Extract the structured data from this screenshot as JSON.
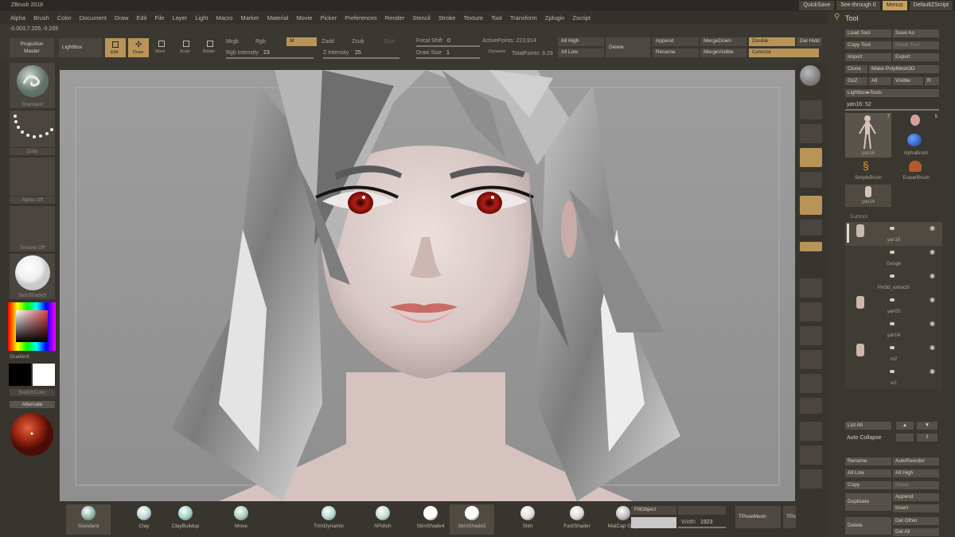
{
  "app": {
    "title": "ZBrush 2018"
  },
  "topbar": [
    "QuickSave",
    "See-through  0",
    "Menus",
    "DefaultZScript"
  ],
  "menus": [
    "Alpha",
    "Brush",
    "Color",
    "Document",
    "Draw",
    "Edit",
    "File",
    "Layer",
    "Light",
    "Macro",
    "Marker",
    "Material",
    "Movie",
    "Picker",
    "Preferences",
    "Render",
    "Stencil",
    "Stroke",
    "Texture",
    "Tool",
    "Transform",
    "Zplugin",
    "Zscript"
  ],
  "coords": "-0.003,7.205,-0.205",
  "shelf": {
    "projection_master": "Projection\nMaster",
    "lightbox": "LightBox",
    "edit": "Edit",
    "draw": "Draw",
    "move": "Move",
    "scale": "Scale",
    "rotate": "Rotate",
    "mrgb": "Mrgb",
    "rgb": "Rgb",
    "m": "M",
    "zadd": "Zadd",
    "zsub": "Zsub",
    "zcut": "Zcut",
    "rgb_intensity_label": "Rgb Intensity",
    "rgb_intensity_value": "23",
    "z_intensity_label": "Z Intensity",
    "z_intensity_value": "25",
    "focal_shift_label": "Focal Shift",
    "focal_shift_value": "0",
    "draw_size_label": "Draw Size",
    "draw_size_value": "1",
    "dynamic": "Dynamic",
    "active_points": "ActivePoints: 223,914",
    "total_points": "TotalPoints: 9.29",
    "all_high": "All High",
    "all_low": "All Low",
    "delete": "Delete",
    "append": "Append",
    "rename": "Rename",
    "merge_down": "MergeDown",
    "merge_visible": "MergeVisible",
    "double": "Double",
    "colorize": "Colorize",
    "del_hidden": "Del Hidd",
    "zero": "0"
  },
  "left": {
    "brush": "Standard",
    "stroke": "Dots",
    "alpha": "Alpha Off",
    "texture": "Texture Off",
    "material": "SkinShade5",
    "gradient": "Gradient",
    "switch_color": "SwitchColor",
    "alternate": "Alternate"
  },
  "right_shelf": [
    "",
    "",
    "Actual",
    "AAHalf",
    "Persp",
    "Floor",
    "Local",
    "L.Sym",
    "Gxyz",
    "",
    "",
    "Frame",
    "Move",
    "Scale",
    "Rotate",
    "Line Fill PolyF",
    "Transp",
    "Ghost",
    "Solo",
    "Xpose"
  ],
  "tool": {
    "title": "Tool",
    "load": "Load Tool",
    "save_as": "Save As",
    "copy": "Copy Tool",
    "paste": "Paste Tool",
    "import": "Import",
    "export": "Export",
    "clone": "Clone",
    "make_polymesh": "Make PolyMesh3D",
    "goz": "GoZ",
    "all": "All",
    "visible": "Visible",
    "r": "R",
    "lightbox_tools": "Lightbox▸Tools",
    "current": "yan16: 52",
    "thumbs": [
      {
        "label": "yan16",
        "count": "7"
      },
      {
        "label": "AlphaBrush",
        "count": "5"
      },
      {
        "label": "SimpleBrush",
        "count": ""
      },
      {
        "label": "EraserBrush",
        "count": ""
      },
      {
        "label": "yan16",
        "count": ""
      }
    ],
    "subtool_title": "Subtool",
    "subtools": [
      "yan16",
      "Geoge",
      "Pm3d_extract0",
      "yan03",
      "yan04",
      "m2",
      "w1"
    ],
    "list_all": "List All",
    "auto_collapse": "Auto Collapse",
    "rename": "Rename",
    "auto_reorder": "AutoReorder",
    "all_low": "All Low",
    "all_high": "All High",
    "copy2": "Copy",
    "paste2": "Paste",
    "duplicate": "Duplicate",
    "append": "Append",
    "insert": "Insert",
    "delete": "Delete",
    "del_other": "Del Other",
    "del_all": "Del All"
  },
  "bottom": {
    "materials": [
      "Standard",
      "Clay",
      "ClayBuildup",
      "Move",
      "TrimDynamic",
      "hPolish",
      "SkinShade4",
      "SkinShade5",
      "Slim",
      "FastShader",
      "MatCap Gray"
    ],
    "fill_object": "FillObject",
    "width_label": "Width",
    "width_value": "1923",
    "tposemesh": "TPoseMesh",
    "tpo": "TPo"
  },
  "colors": {
    "accent": "#c8a05a",
    "canvas": "#9a9a9a",
    "panel": "#3a3731"
  }
}
